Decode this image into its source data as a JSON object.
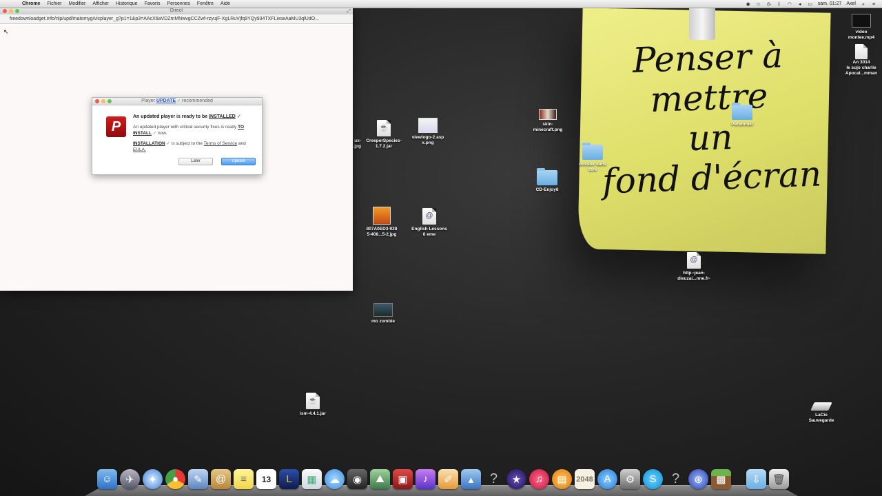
{
  "menubar": {
    "apple": "",
    "menus": [
      "Chrome",
      "Fichier",
      "Modifier",
      "Afficher",
      "Historique",
      "Favoris",
      "Personnes",
      "Fenêtre",
      "Aide"
    ],
    "clock": "sam. 01:27",
    "user": "Axel"
  },
  "browser": {
    "title": "Direct",
    "url": "freedownloadget.info/nlp/upd/matomyg/vicplayer_g?p1=1&p3=AAcX6aVDZmMNwvgCCZwf-rzyujF-XgLRuVjfq9YQy934TXFLixseAaMU3qlUdO..."
  },
  "popup": {
    "title_prefix": "Player",
    "title_update": "UPDATE",
    "title_suffix": "recommended",
    "logo_letter": "P",
    "heading_prefix": "An updated player is ready to be",
    "heading_strong": "INSTALLED",
    "line2_prefix": "An updated player with critical security fixes is ready",
    "line2_strong": "TO INSTALL",
    "line2_suffix": "now.",
    "line3_strong": "INSTALLATION",
    "line3_mid": "is subject to the",
    "line3_tos": "Terms of Service",
    "line3_and": "and",
    "line3_eula": "EULA.",
    "btn_later": "Later",
    "btn_update": "Update"
  },
  "note": {
    "lines": [
      "Penser à",
      "mettre",
      "un",
      "fond d'écran"
    ]
  },
  "desktop_icons": {
    "video": "video\nmontee.mp4",
    "an3014": "An 3014\nle sujo charlie\nApocal...mman",
    "skin": "skin-\nminecraft.png",
    "personnel": "Personnel",
    "dossier": "dossier sans\ntitre",
    "cdenjoy": "CD-Enjoy6",
    "creeper": "CreeperSpecies-\n1.7.2.jar",
    "viewlogo": "viewlogo-2.asp\nx.png",
    "partial": "ux-\n...jpg",
    "img807": "807A0ED3-928\n5-408...5-2.jpg",
    "english": "English Lessons\n6 eme",
    "http": "http--jean-\ndieuzai...nne.fr-",
    "zombie": "mo zombie",
    "ism": "ism-4.4.1.jar",
    "lacie": "LaCie\nSauvegarde"
  },
  "dock": {
    "calendar_day": "13",
    "game_2048": "2048"
  },
  "colors": {
    "note": "#e4e47a",
    "update_blue": "#4e9cf0",
    "logo_red": "#c41616"
  }
}
